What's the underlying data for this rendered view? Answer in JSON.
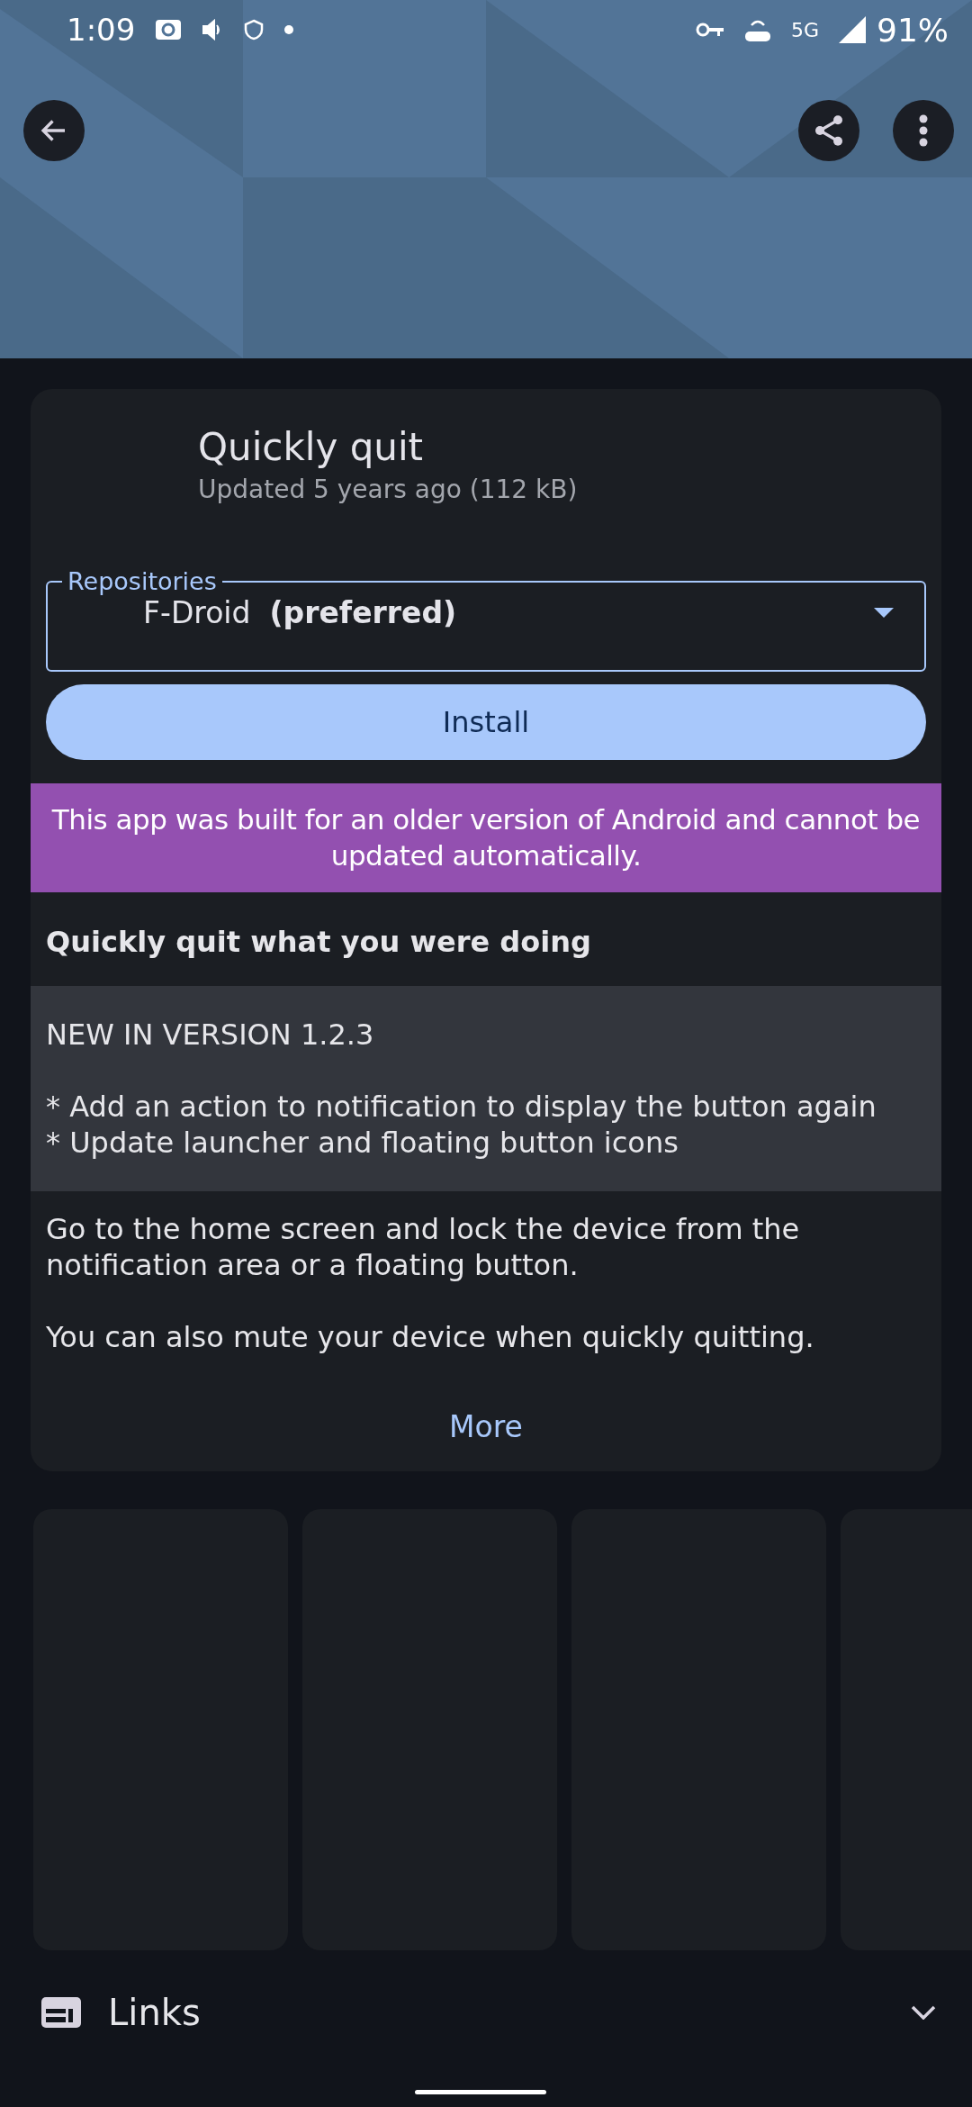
{
  "status_bar": {
    "time": "1:09",
    "network": "5G",
    "battery": "91%"
  },
  "app": {
    "name": "Quickly quit",
    "subtitle": "Updated 5 years ago (112 kB)"
  },
  "repository_field": {
    "label": "Repositories",
    "value": "F-Droid  **(preferred)**"
  },
  "install_button": "Install",
  "warning": "This app was built for an older version of Android and cannot be updated automatically.",
  "summary": "Quickly quit what you were doing",
  "whats_new": [
    "NEW IN VERSION 1.2.3",
    "* Add an action to notification to display the button again\n* Update launcher and floating button icons"
  ],
  "description": [
    "Go to the home screen and lock the device from the notification area or a floating button.",
    "You can also mute your device when quickly quitting."
  ],
  "more_link": "More",
  "links_section": {
    "title": "Links",
    "expanded": false
  }
}
